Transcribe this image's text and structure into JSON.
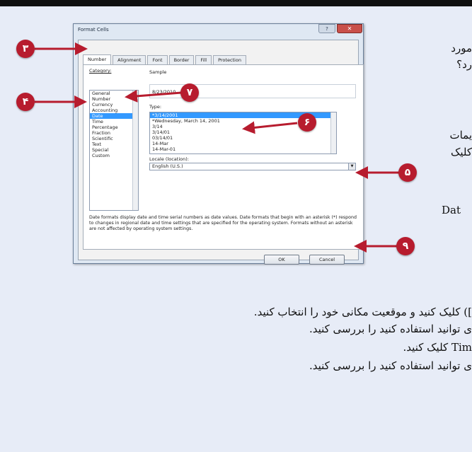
{
  "dialog": {
    "title": "Format Cells",
    "help_glyph": "?",
    "close_glyph": "✕",
    "tabs": [
      "Number",
      "Alignment",
      "Font",
      "Border",
      "Fill",
      "Protection"
    ],
    "category_label": "Category:",
    "categories": [
      "General",
      "Number",
      "Currency",
      "Accounting",
      "Date",
      "Time",
      "Percentage",
      "Fraction",
      "Scientific",
      "Text",
      "Special",
      "Custom"
    ],
    "selected_category": "Date",
    "sample_label": "Sample",
    "sample_value": "8/23/2010",
    "type_label": "Type:",
    "types": [
      "*3/14/2001",
      "*Wednesday, March 14, 2001",
      "3/14",
      "3/14/01",
      "03/14/01",
      "14-Mar",
      "14-Mar-01"
    ],
    "locale_label": "Locale (location):",
    "locale_value": "English (U.S.)",
    "description": "Date formats display date and time serial numbers as date values.  Date formats that begin with an asterisk (*) respond to changes in regional date and time settings that are specified for the operating system. Formats without an asterisk are not affected by operating system settings.",
    "ok_label": "OK",
    "cancel_label": "Cancel"
  },
  "callouts": [
    "۳",
    "۴",
    "۷",
    "۶",
    "۵",
    "۹"
  ],
  "page_text": {
    "right_1": "مورد",
    "right_2": "رد؟",
    "right_3": "یمات",
    "right_4": "کلیک",
    "right_5": "Dat",
    "line_1": "]) کلیک کنید و موقعیت مکانی خود را انتخاب کنید.",
    "line_2": "ی توانید استفاده کنید را بررسی کنید.",
    "line_3": "Tim  کلیک کنید.",
    "line_4": "ی توانید استفاده کنید را بررسی کنید."
  },
  "colors": {
    "callout": "#b71c2e",
    "selection": "#3399ff",
    "page_bg": "#e7ecf7"
  }
}
